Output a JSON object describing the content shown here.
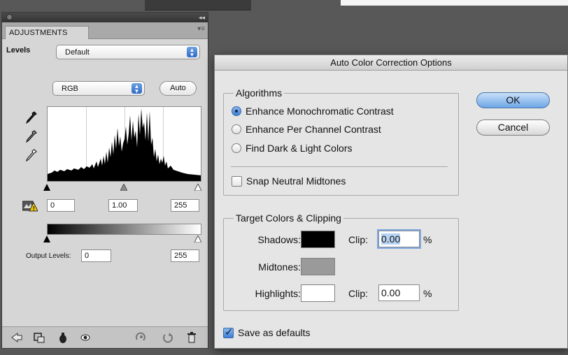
{
  "panel": {
    "tab_label": "ADJUSTMENTS",
    "adjustment_type": "Levels",
    "preset_value": "Default",
    "channel_value": "RGB",
    "auto_label": "Auto",
    "input_black": "0",
    "input_gamma": "1.00",
    "input_white": "255",
    "output_label": "Output Levels:",
    "output_black": "0",
    "output_white": "255",
    "icons": [
      "eyedropper-black-icon",
      "eyedropper-gray-icon",
      "eyedropper-white-icon",
      "clipping-warning-icon",
      "back-arrow-icon",
      "clip-to-layer-icon",
      "visibility-toggle-icon",
      "eye-icon",
      "previous-state-icon",
      "reset-icon",
      "trash-icon"
    ]
  },
  "dialog": {
    "title": "Auto Color Correction Options",
    "algorithms_label": "Algorithms",
    "algorithms": [
      {
        "label": "Enhance Monochromatic Contrast",
        "selected": true
      },
      {
        "label": "Enhance Per Channel Contrast",
        "selected": false
      },
      {
        "label": "Find Dark & Light Colors",
        "selected": false
      }
    ],
    "snap_label": "Snap Neutral Midtones",
    "snap_checked": false,
    "target_label": "Target Colors & Clipping",
    "shadows_label": "Shadows:",
    "midtones_label": "Midtones:",
    "highlights_label": "Highlights:",
    "clip_label": "Clip:",
    "shadows_clip": "0.00",
    "highlights_clip": "0.00",
    "percent": "%",
    "shadows_color": "#000000",
    "midtones_color": "#9a9a9a",
    "highlights_color": "#ffffff",
    "ok_label": "OK",
    "cancel_label": "Cancel",
    "save_defaults_label": "Save as defaults",
    "save_defaults_checked": true
  }
}
